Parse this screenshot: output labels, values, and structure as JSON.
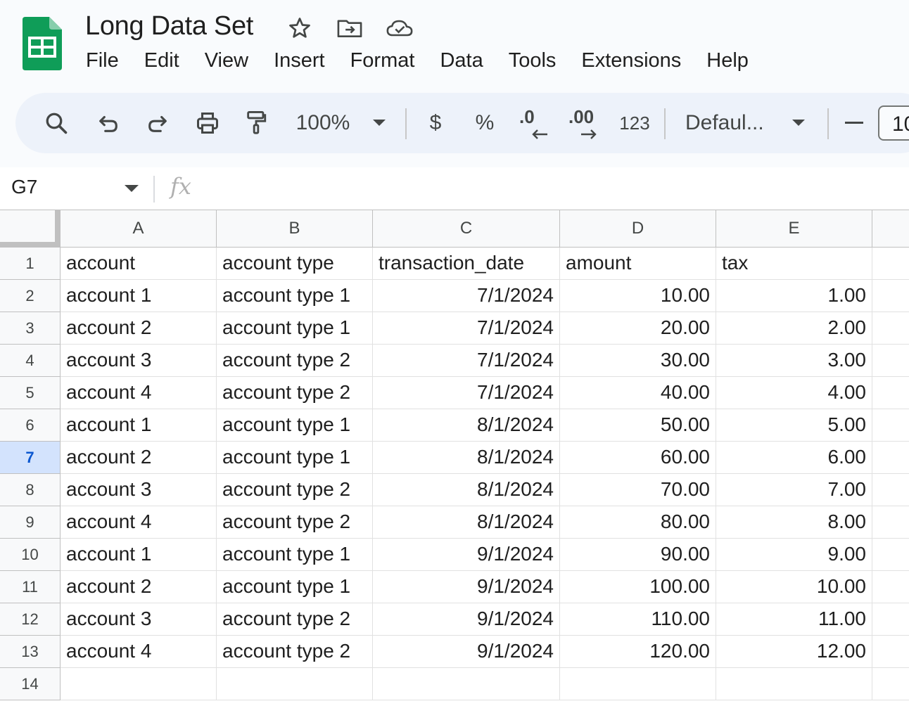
{
  "document": {
    "title": "Long Data Set"
  },
  "menu": [
    "File",
    "Edit",
    "View",
    "Insert",
    "Format",
    "Data",
    "Tools",
    "Extensions",
    "Help"
  ],
  "toolbar": {
    "zoom": "100%",
    "currency": "$",
    "percent": "%",
    "decrease_decimal": ".0",
    "increase_decimal": ".00",
    "number_format": "123",
    "font": "Defaul...",
    "font_size": "10"
  },
  "formula_bar": {
    "cell_ref": "G7",
    "fx_label": "fx",
    "content": ""
  },
  "colors": {
    "accent": "#0b57d0",
    "selected_row_header": "#d3e3fd",
    "sheets_green": "#0f9d58"
  },
  "grid": {
    "columns": [
      "A",
      "B",
      "C",
      "D",
      "E"
    ],
    "row_numbers": [
      "1",
      "2",
      "3",
      "4",
      "5",
      "6",
      "7",
      "8",
      "9",
      "10",
      "11",
      "12",
      "13",
      "14"
    ],
    "selected_row": "7",
    "rows": [
      [
        "account",
        "account type",
        "transaction_date",
        "amount",
        "tax"
      ],
      [
        "account 1",
        "account type 1",
        "7/1/2024",
        "10.00",
        "1.00"
      ],
      [
        "account 2",
        "account type 1",
        "7/1/2024",
        "20.00",
        "2.00"
      ],
      [
        "account 3",
        "account type 2",
        "7/1/2024",
        "30.00",
        "3.00"
      ],
      [
        "account 4",
        "account type 2",
        "7/1/2024",
        "40.00",
        "4.00"
      ],
      [
        "account 1",
        "account type 1",
        "8/1/2024",
        "50.00",
        "5.00"
      ],
      [
        "account 2",
        "account type 1",
        "8/1/2024",
        "60.00",
        "6.00"
      ],
      [
        "account 3",
        "account type 2",
        "8/1/2024",
        "70.00",
        "7.00"
      ],
      [
        "account 4",
        "account type 2",
        "8/1/2024",
        "80.00",
        "8.00"
      ],
      [
        "account 1",
        "account type 1",
        "9/1/2024",
        "90.00",
        "9.00"
      ],
      [
        "account 2",
        "account type 1",
        "9/1/2024",
        "100.00",
        "10.00"
      ],
      [
        "account 3",
        "account type 2",
        "9/1/2024",
        "110.00",
        "11.00"
      ],
      [
        "account 4",
        "account type 2",
        "9/1/2024",
        "120.00",
        "12.00"
      ],
      [
        "",
        "",
        "",
        "",
        ""
      ]
    ]
  }
}
